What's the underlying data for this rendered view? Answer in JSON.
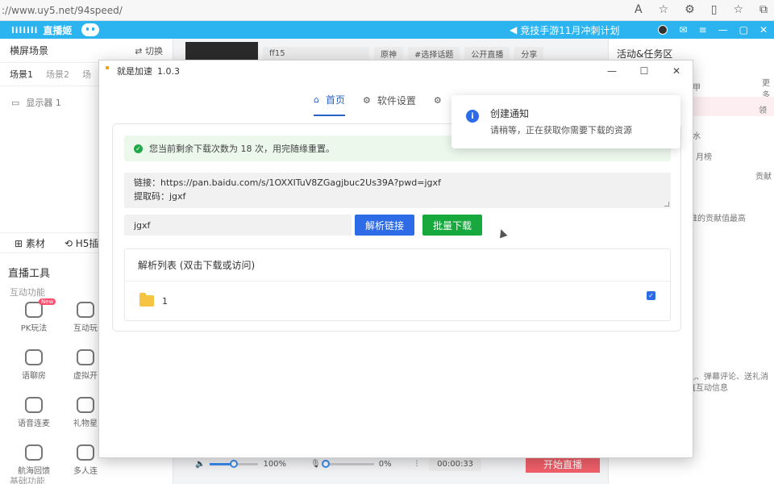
{
  "browser": {
    "url": "://www.uy5.net/94speed/"
  },
  "app_header": {
    "logo_text": "liliili",
    "app_name": "直播姬",
    "announcement": "竞技手游11月冲刺计划",
    "brand_color": "#2bb4f0"
  },
  "left_panel": {
    "title": "横屏场景",
    "switch_label": "切换",
    "scene_tabs": [
      "场景1",
      "场景2",
      "场"
    ],
    "source_item": "显示器 1",
    "material_tabs": [
      "素材",
      "H5插"
    ],
    "tools_title": "直播工具",
    "interactive_title": "互动功能",
    "tools": [
      {
        "label": "PK玩法",
        "badge": "New"
      },
      {
        "label": "互动玩"
      },
      {
        "label": "语聊房"
      },
      {
        "label": "虚拟开"
      },
      {
        "label": "语音连麦"
      },
      {
        "label": "礼物星"
      },
      {
        "label": "航海回馈"
      },
      {
        "label": "多人连"
      }
    ],
    "basic_title": "基础功能"
  },
  "center": {
    "room_title": "ff15",
    "chips": [
      "原神",
      "#选择话题",
      "公开直播",
      "分享"
    ],
    "volume_percent": "100%",
    "mic_percent": "0%",
    "timer": "00:00:33",
    "start_label": "开始直播",
    "volume_level": 0.5,
    "mic_level": 0.0
  },
  "right_panel": {
    "title": "活动&任务区",
    "more": "更多",
    "lines": [
      "甲",
      "领",
      "水",
      "月榜",
      "贡献",
      "谁的贡献值最高",
      "礼、弹幕评论、送礼消息",
      "有互动信息"
    ]
  },
  "modal": {
    "title": "就是加速",
    "version": "1.0.3",
    "tabs": [
      {
        "icon": "home-icon",
        "label": "首页",
        "active": true
      },
      {
        "icon": "gear-icon",
        "label": "软件设置",
        "active": false
      }
    ],
    "alert_text": "您当前剩余下载次数为 18 次，用完随缘重置。",
    "link_line1": "链接：https://pan.baidu.com/s/1OXXITuV8ZGagjbuc2Us39A?pwd=jgxf",
    "link_line2": "提取码：jgxf",
    "code_value": "jgxf",
    "parse_button": "解析链接",
    "batch_button": "批量下载",
    "list_title": "解析列表 (双击下载或访问)",
    "list_items": [
      {
        "name": "1",
        "checked": true
      }
    ],
    "accent": "#2e6be6",
    "success": "#17a83e"
  },
  "toast": {
    "title": "创建通知",
    "message": "请稍等，正在获取你需要下载的资源"
  }
}
